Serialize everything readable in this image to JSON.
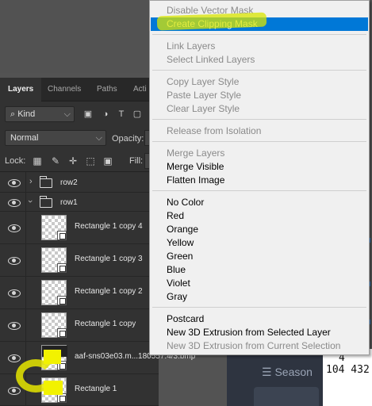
{
  "layers_panel": {
    "tabs": [
      "Layers",
      "Channels",
      "Paths",
      "Acti"
    ],
    "filter_kind": "Kind",
    "blend_mode": "Normal",
    "opacity_label": "Opacity:",
    "lock_label": "Lock:",
    "fill_label": "Fill:",
    "layers": [
      {
        "name": "row2",
        "type": "group",
        "expanded": false
      },
      {
        "name": "row1",
        "type": "group",
        "expanded": true
      },
      {
        "name": "Rectangle 1 copy 4",
        "type": "shape"
      },
      {
        "name": "Rectangle 1 copy 3",
        "type": "shape"
      },
      {
        "name": "Rectangle 1 copy 2",
        "type": "shape"
      },
      {
        "name": "Rectangle 1 copy",
        "type": "shape"
      },
      {
        "name": "aaf-sns03e03.m...180557.4/3.bmp",
        "type": "image"
      },
      {
        "name": "Rectangle 1",
        "type": "shape"
      }
    ]
  },
  "context_menu": {
    "groups": [
      [
        {
          "label": "Disable Vector Mask",
          "disabled": true
        },
        {
          "label": "Create Clipping Mask",
          "disabled": false,
          "selected": true
        }
      ],
      [
        {
          "label": "Link Layers",
          "disabled": true
        },
        {
          "label": "Select Linked Layers",
          "disabled": true
        }
      ],
      [
        {
          "label": "Copy Layer Style",
          "disabled": true
        },
        {
          "label": "Paste Layer Style",
          "disabled": true
        },
        {
          "label": "Clear Layer Style",
          "disabled": true
        }
      ],
      [
        {
          "label": "Release from Isolation",
          "disabled": true
        }
      ],
      [
        {
          "label": "Merge Layers",
          "disabled": true
        },
        {
          "label": "Merge Visible",
          "disabled": false
        },
        {
          "label": "Flatten Image",
          "disabled": false
        }
      ],
      [
        {
          "label": "No Color",
          "disabled": false
        },
        {
          "label": "Red",
          "disabled": false
        },
        {
          "label": "Orange",
          "disabled": false
        },
        {
          "label": "Yellow",
          "disabled": false
        },
        {
          "label": "Green",
          "disabled": false
        },
        {
          "label": "Blue",
          "disabled": false
        },
        {
          "label": "Violet",
          "disabled": false
        },
        {
          "label": "Gray",
          "disabled": false
        }
      ],
      [
        {
          "label": "Postcard",
          "disabled": false
        },
        {
          "label": "New 3D Extrusion from Selected Layer",
          "disabled": false
        },
        {
          "label": "New 3D Extrusion from Current Selection",
          "disabled": true
        }
      ]
    ]
  },
  "background": {
    "season_label": "Season",
    "numbers": [
      "4",
      "104 432"
    ]
  },
  "colors": {
    "menu_selected": "#0078d7",
    "highlighter": "#e6e600",
    "panel_bg": "#323232"
  }
}
